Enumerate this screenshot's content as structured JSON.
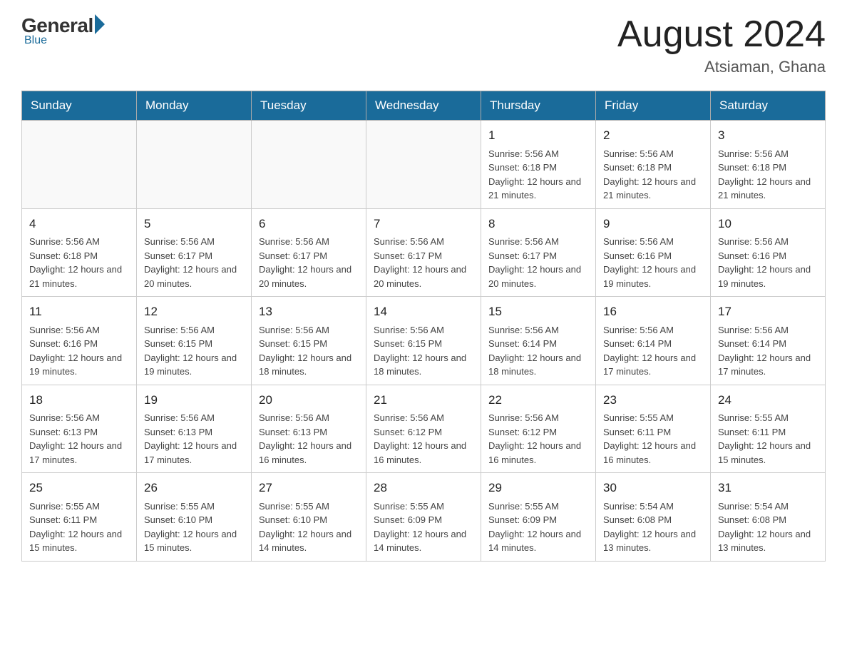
{
  "logo": {
    "general": "General",
    "blue": "Blue"
  },
  "title": {
    "month_year": "August 2024",
    "location": "Atsiaman, Ghana"
  },
  "days_of_week": [
    "Sunday",
    "Monday",
    "Tuesday",
    "Wednesday",
    "Thursday",
    "Friday",
    "Saturday"
  ],
  "weeks": [
    [
      {
        "day": "",
        "sunrise": "",
        "sunset": "",
        "daylight": ""
      },
      {
        "day": "",
        "sunrise": "",
        "sunset": "",
        "daylight": ""
      },
      {
        "day": "",
        "sunrise": "",
        "sunset": "",
        "daylight": ""
      },
      {
        "day": "",
        "sunrise": "",
        "sunset": "",
        "daylight": ""
      },
      {
        "day": "1",
        "sunrise": "Sunrise: 5:56 AM",
        "sunset": "Sunset: 6:18 PM",
        "daylight": "Daylight: 12 hours and 21 minutes."
      },
      {
        "day": "2",
        "sunrise": "Sunrise: 5:56 AM",
        "sunset": "Sunset: 6:18 PM",
        "daylight": "Daylight: 12 hours and 21 minutes."
      },
      {
        "day": "3",
        "sunrise": "Sunrise: 5:56 AM",
        "sunset": "Sunset: 6:18 PM",
        "daylight": "Daylight: 12 hours and 21 minutes."
      }
    ],
    [
      {
        "day": "4",
        "sunrise": "Sunrise: 5:56 AM",
        "sunset": "Sunset: 6:18 PM",
        "daylight": "Daylight: 12 hours and 21 minutes."
      },
      {
        "day": "5",
        "sunrise": "Sunrise: 5:56 AM",
        "sunset": "Sunset: 6:17 PM",
        "daylight": "Daylight: 12 hours and 20 minutes."
      },
      {
        "day": "6",
        "sunrise": "Sunrise: 5:56 AM",
        "sunset": "Sunset: 6:17 PM",
        "daylight": "Daylight: 12 hours and 20 minutes."
      },
      {
        "day": "7",
        "sunrise": "Sunrise: 5:56 AM",
        "sunset": "Sunset: 6:17 PM",
        "daylight": "Daylight: 12 hours and 20 minutes."
      },
      {
        "day": "8",
        "sunrise": "Sunrise: 5:56 AM",
        "sunset": "Sunset: 6:17 PM",
        "daylight": "Daylight: 12 hours and 20 minutes."
      },
      {
        "day": "9",
        "sunrise": "Sunrise: 5:56 AM",
        "sunset": "Sunset: 6:16 PM",
        "daylight": "Daylight: 12 hours and 19 minutes."
      },
      {
        "day": "10",
        "sunrise": "Sunrise: 5:56 AM",
        "sunset": "Sunset: 6:16 PM",
        "daylight": "Daylight: 12 hours and 19 minutes."
      }
    ],
    [
      {
        "day": "11",
        "sunrise": "Sunrise: 5:56 AM",
        "sunset": "Sunset: 6:16 PM",
        "daylight": "Daylight: 12 hours and 19 minutes."
      },
      {
        "day": "12",
        "sunrise": "Sunrise: 5:56 AM",
        "sunset": "Sunset: 6:15 PM",
        "daylight": "Daylight: 12 hours and 19 minutes."
      },
      {
        "day": "13",
        "sunrise": "Sunrise: 5:56 AM",
        "sunset": "Sunset: 6:15 PM",
        "daylight": "Daylight: 12 hours and 18 minutes."
      },
      {
        "day": "14",
        "sunrise": "Sunrise: 5:56 AM",
        "sunset": "Sunset: 6:15 PM",
        "daylight": "Daylight: 12 hours and 18 minutes."
      },
      {
        "day": "15",
        "sunrise": "Sunrise: 5:56 AM",
        "sunset": "Sunset: 6:14 PM",
        "daylight": "Daylight: 12 hours and 18 minutes."
      },
      {
        "day": "16",
        "sunrise": "Sunrise: 5:56 AM",
        "sunset": "Sunset: 6:14 PM",
        "daylight": "Daylight: 12 hours and 17 minutes."
      },
      {
        "day": "17",
        "sunrise": "Sunrise: 5:56 AM",
        "sunset": "Sunset: 6:14 PM",
        "daylight": "Daylight: 12 hours and 17 minutes."
      }
    ],
    [
      {
        "day": "18",
        "sunrise": "Sunrise: 5:56 AM",
        "sunset": "Sunset: 6:13 PM",
        "daylight": "Daylight: 12 hours and 17 minutes."
      },
      {
        "day": "19",
        "sunrise": "Sunrise: 5:56 AM",
        "sunset": "Sunset: 6:13 PM",
        "daylight": "Daylight: 12 hours and 17 minutes."
      },
      {
        "day": "20",
        "sunrise": "Sunrise: 5:56 AM",
        "sunset": "Sunset: 6:13 PM",
        "daylight": "Daylight: 12 hours and 16 minutes."
      },
      {
        "day": "21",
        "sunrise": "Sunrise: 5:56 AM",
        "sunset": "Sunset: 6:12 PM",
        "daylight": "Daylight: 12 hours and 16 minutes."
      },
      {
        "day": "22",
        "sunrise": "Sunrise: 5:56 AM",
        "sunset": "Sunset: 6:12 PM",
        "daylight": "Daylight: 12 hours and 16 minutes."
      },
      {
        "day": "23",
        "sunrise": "Sunrise: 5:55 AM",
        "sunset": "Sunset: 6:11 PM",
        "daylight": "Daylight: 12 hours and 16 minutes."
      },
      {
        "day": "24",
        "sunrise": "Sunrise: 5:55 AM",
        "sunset": "Sunset: 6:11 PM",
        "daylight": "Daylight: 12 hours and 15 minutes."
      }
    ],
    [
      {
        "day": "25",
        "sunrise": "Sunrise: 5:55 AM",
        "sunset": "Sunset: 6:11 PM",
        "daylight": "Daylight: 12 hours and 15 minutes."
      },
      {
        "day": "26",
        "sunrise": "Sunrise: 5:55 AM",
        "sunset": "Sunset: 6:10 PM",
        "daylight": "Daylight: 12 hours and 15 minutes."
      },
      {
        "day": "27",
        "sunrise": "Sunrise: 5:55 AM",
        "sunset": "Sunset: 6:10 PM",
        "daylight": "Daylight: 12 hours and 14 minutes."
      },
      {
        "day": "28",
        "sunrise": "Sunrise: 5:55 AM",
        "sunset": "Sunset: 6:09 PM",
        "daylight": "Daylight: 12 hours and 14 minutes."
      },
      {
        "day": "29",
        "sunrise": "Sunrise: 5:55 AM",
        "sunset": "Sunset: 6:09 PM",
        "daylight": "Daylight: 12 hours and 14 minutes."
      },
      {
        "day": "30",
        "sunrise": "Sunrise: 5:54 AM",
        "sunset": "Sunset: 6:08 PM",
        "daylight": "Daylight: 12 hours and 13 minutes."
      },
      {
        "day": "31",
        "sunrise": "Sunrise: 5:54 AM",
        "sunset": "Sunset: 6:08 PM",
        "daylight": "Daylight: 12 hours and 13 minutes."
      }
    ]
  ]
}
